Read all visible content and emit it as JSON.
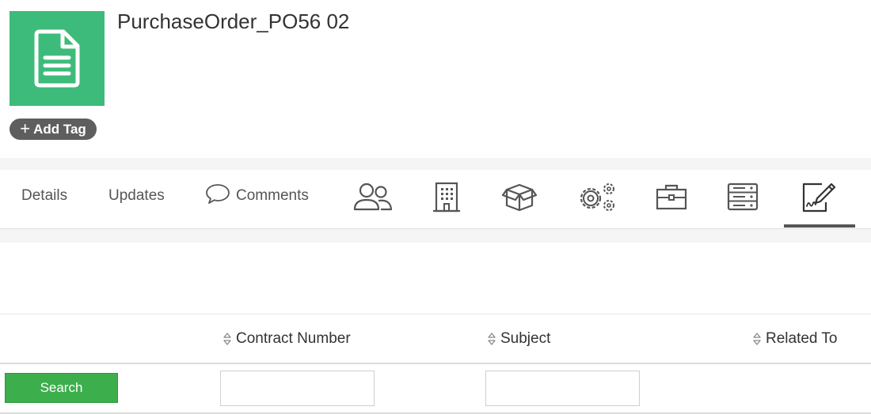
{
  "record": {
    "title": "PurchaseOrder_PO56 02",
    "icon": "document-icon",
    "add_tag_label": "Add Tag"
  },
  "tabs": {
    "details": "Details",
    "updates": "Updates",
    "comments": "Comments",
    "icon_tabs": [
      "contacts-icon",
      "building-icon",
      "box-icon",
      "gears-icon",
      "briefcase-icon",
      "server-icon",
      "contract-sign-icon"
    ],
    "active": "contract-sign-icon"
  },
  "table": {
    "columns": [
      "Contract Number",
      "Subject",
      "Related To"
    ],
    "search_label": "Search",
    "filters": {
      "contract_number": "",
      "subject": ""
    }
  },
  "colors": {
    "icon_bg": "#3dbb7a",
    "tag_bg": "#5e5e5e",
    "search_btn": "#3cae4c"
  }
}
